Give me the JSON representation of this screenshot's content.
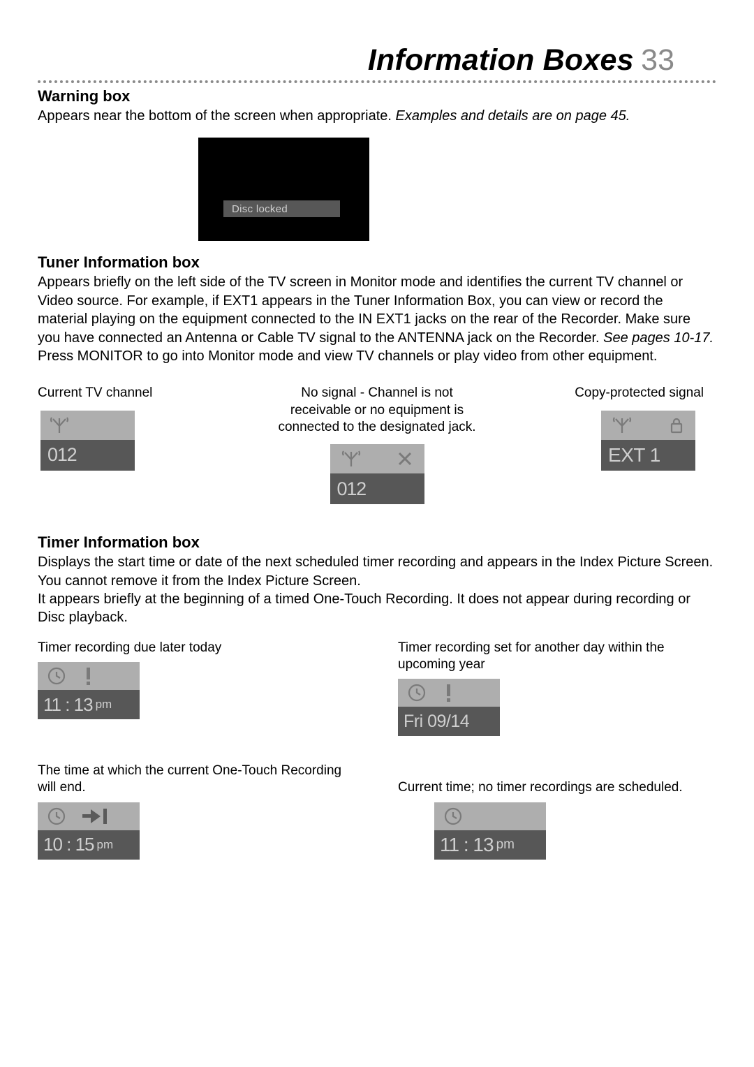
{
  "page_title": "Information Boxes",
  "page_number": "33",
  "sections": {
    "warning": {
      "heading": "Warning box",
      "body_plain": "Appears near the bottom of the screen when appropriate. ",
      "body_italic": "Examples and details are on page 45.",
      "screen_label": "Disc locked"
    },
    "tuner": {
      "heading": "Tuner Information box",
      "body": "Appears briefly on the left side of the TV screen in Monitor mode and identifies the current TV channel or Video source. For example, if EXT1 appears in the Tuner Information Box, you can view or record the material playing on the equipment connected to the IN EXT1 jacks on the rear of the Recorder. Make sure you have connected an Antenna or Cable TV signal to the ANTENNA jack on the Recorder. ",
      "body_italic": "See pages 10-17.",
      "body_tail": " Press MONITOR to go into Monitor mode and view TV channels or play video from other equipment.",
      "cols": {
        "left": {
          "caption": "Current TV channel",
          "value": "012"
        },
        "center": {
          "caption": "No signal - Channel is not receivable or no equipment is connected to the designated jack.",
          "value": "012"
        },
        "right": {
          "caption": "Copy-protected signal",
          "value": "EXT 1"
        }
      }
    },
    "timer": {
      "heading": "Timer Information box",
      "body1": "Displays the start time or date of the next scheduled timer recording and appears in the Index Picture Screen. You cannot remove it from the Index Picture Screen.",
      "body2": "It appears briefly at the beginning of a timed One-Touch Recording. It does not appear during recording or Disc playback.",
      "items": {
        "today": {
          "caption": "Timer recording due later today",
          "time": "11 : 13",
          "ampm": "pm"
        },
        "future": {
          "caption": "Timer recording set for another day within the upcoming year",
          "date": "Fri 09/14"
        },
        "otr_end": {
          "caption": "The time at which the current One-Touch Recording will end.",
          "time": "10 : 15",
          "ampm": "pm"
        },
        "now": {
          "caption": "Current time; no timer recordings are scheduled.",
          "time": "11 : 13",
          "ampm": "pm"
        }
      }
    }
  }
}
